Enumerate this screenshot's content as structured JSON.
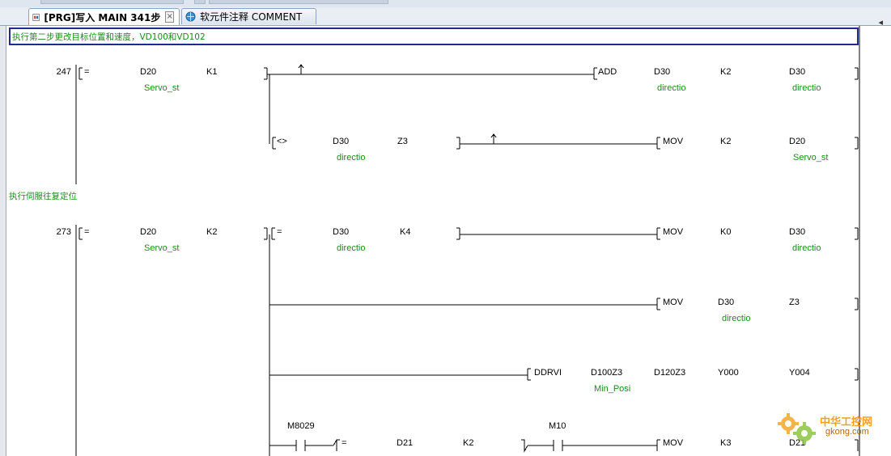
{
  "tabs": [
    {
      "label": "[PRG]写入 MAIN 341步",
      "close": "×"
    },
    {
      "label": "软元件注释 COMMENT"
    }
  ],
  "scroll_left_glyph": "◂",
  "comments": [
    "执行第二步更改目标位置和速度，VD100和VD102",
    "执行伺服往复定位"
  ],
  "steps": [
    "247",
    "273"
  ],
  "rung247": {
    "cmp1": {
      "op": "=",
      "a": "D20",
      "a_note": "Servo_st",
      "b": "K1"
    },
    "out1": {
      "op": "ADD",
      "a": "D30",
      "a_note": "directio",
      "b": "K2",
      "c": "D30",
      "c_note": "directio"
    },
    "cmp2": {
      "op": "<>",
      "a": "D30",
      "a_note": "directio",
      "b": "Z3"
    },
    "out2": {
      "op": "MOV",
      "a": "K2",
      "b": "D20",
      "b_note": "Servo_st"
    }
  },
  "rung273": {
    "cmp1": {
      "op": "=",
      "a": "D20",
      "a_note": "Servo_st",
      "b": "K2"
    },
    "cmp2": {
      "op": "=",
      "a": "D30",
      "a_note": "directio",
      "b": "K4"
    },
    "out1": {
      "op": "MOV",
      "a": "K0",
      "b": "D30",
      "b_note": "directio"
    },
    "out2": {
      "op": "MOV",
      "a": "D30",
      "a_note": "directio",
      "b": "Z3"
    },
    "out3": {
      "op": "DDRVI",
      "a": "D100Z3",
      "a_note": "Min_Posi",
      "b": "D120Z3",
      "c": "Y000",
      "d": "Y004"
    },
    "contact1": "M8029",
    "cmp3": {
      "op": "=",
      "a": "D21",
      "b": "K2"
    },
    "contact2": "M10",
    "out4": {
      "op": "MOV",
      "a": "K3",
      "b": "D21"
    }
  },
  "watermark": {
    "title": "中华工控网",
    "url": "gkong.com"
  }
}
